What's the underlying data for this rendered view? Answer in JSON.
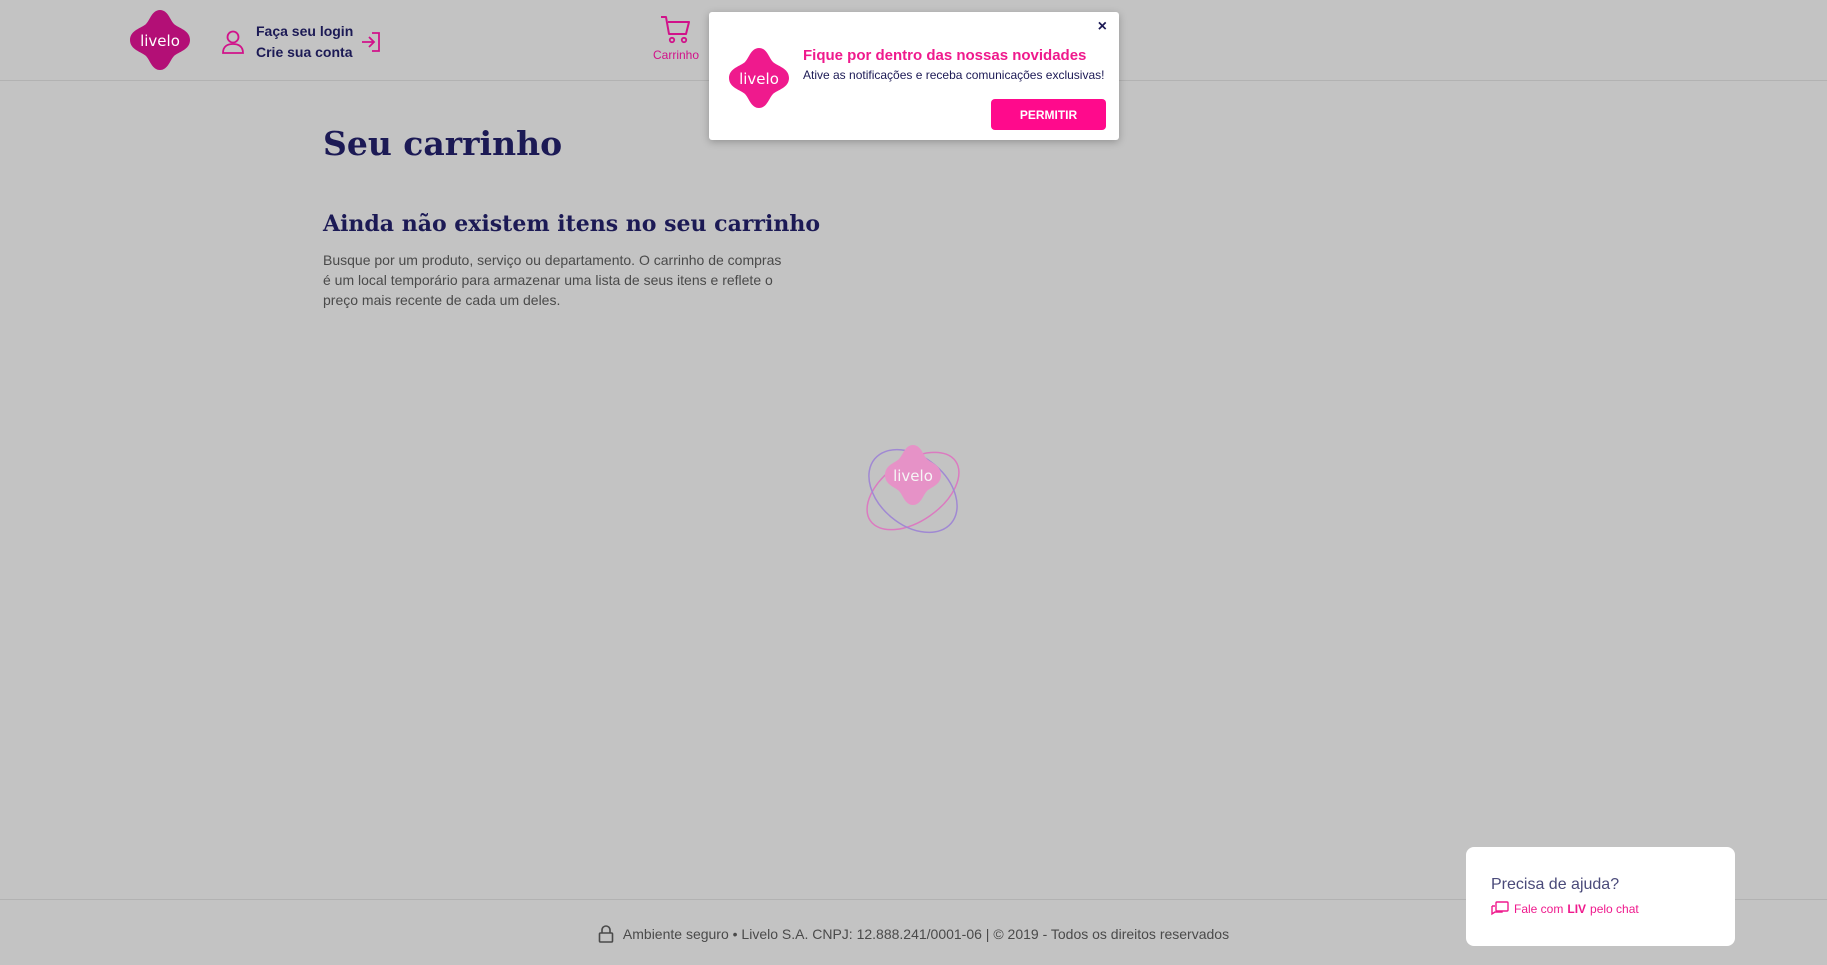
{
  "header": {
    "logo_text": "livelo",
    "login_label": "Faça seu login",
    "signup_label": "Crie sua conta",
    "cart_label": "Carrinho"
  },
  "main": {
    "title": "Seu carrinho",
    "empty_title": "Ainda não existem itens no seu carrinho",
    "empty_description": "Busque por um produto, serviço ou departamento. O carrinho de compras é um local temporário para armazenar uma lista de seus itens e reflete o preço mais recente de cada um deles."
  },
  "loader": {
    "logo_text": "livelo"
  },
  "notification": {
    "close_label": "×",
    "logo_text": "livelo",
    "title": "Fique por dentro das nossas novidades",
    "subtitle": "Ative as notificações e receba comunicações exclusivas!",
    "button_label": "PERMITIR"
  },
  "footer": {
    "text": "Ambiente seguro • Livelo S.A. CNPJ: 12.888.241/0001-06 | © 2019 - Todos os direitos reservados"
  },
  "help": {
    "title": "Precisa de ajuda?",
    "chat_prefix": "Fale com",
    "chat_name": "LIV",
    "chat_suffix": "pelo chat"
  },
  "colors": {
    "brand_pink": "#ef1a8d",
    "brand_navy": "#1c1a55",
    "overlay_bg": "#c3c3c3"
  }
}
